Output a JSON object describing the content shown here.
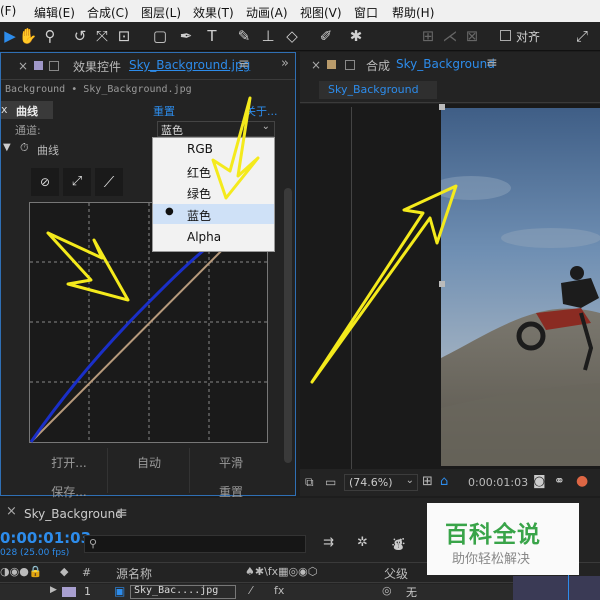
{
  "menubar": {
    "items": [
      "(F)",
      "编辑(E)",
      "合成(C)",
      "图层(L)",
      "效果(T)",
      "动画(A)",
      "视图(V)",
      "窗口",
      "帮助(H)"
    ]
  },
  "toolbar": {
    "snap_label": "对齐"
  },
  "effects_panel": {
    "close_glyph": "×",
    "title": "效果控件",
    "file": "Sky_Background.jpg",
    "subheader": "Background • Sky_Background.jpg",
    "fx_letters": "x",
    "effect_name": "曲线",
    "reset_label": "重置",
    "about_label": "关于...",
    "channel_label": "通道:",
    "channel_value": "蓝色",
    "curves_label": "曲线",
    "buttons": [
      "打开...",
      "自动",
      "平滑",
      "保存...",
      "重置"
    ]
  },
  "channel_dropdown": {
    "options": [
      "RGB",
      "红色",
      "绿色",
      "蓝色",
      "Alpha"
    ],
    "selected_index": 3
  },
  "comp_panel": {
    "close_glyph": "×",
    "title_prefix": "合成",
    "comp_name": "Sky_Background",
    "tab_label": "Sky_Background",
    "zoom": "(74.6%)",
    "timecode": "0:00:01:03"
  },
  "timeline": {
    "comp_name": "Sky_Background",
    "timecode": "0:00:01:03",
    "fps_info": "028 (25.00 fps)",
    "search_placeholder": "",
    "col_num": "#",
    "col_source": "源名称",
    "col_parent": "父级",
    "layer_index": "1",
    "layer_name": "Sky_Bac....jpg",
    "parent_value": "无"
  },
  "watermark": {
    "line1": "百科全说",
    "line2": "助你轻松解决"
  },
  "colors": {
    "accent": "#2d8ceb",
    "annotation": "#f4ea1c",
    "curve_blue": "#1a2fc8",
    "curve_baseline": "#b79a7c"
  }
}
